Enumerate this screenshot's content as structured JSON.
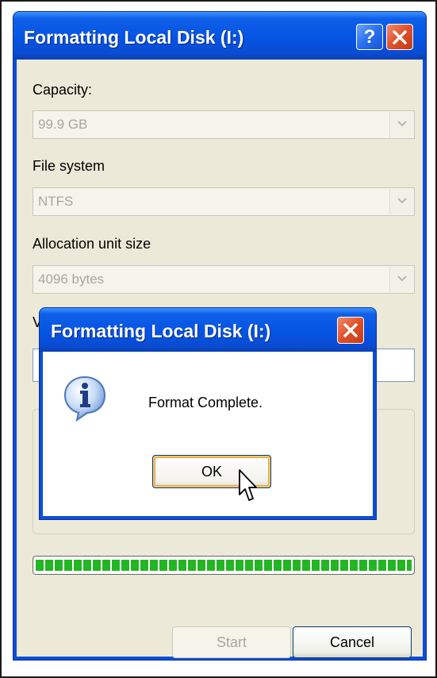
{
  "main_window": {
    "title": "Formatting Local Disk (I:)",
    "help_label": "?",
    "capacity": {
      "label": "Capacity:",
      "value": "99.9 GB"
    },
    "file_system": {
      "label": "File system",
      "value": "NTFS"
    },
    "allocation": {
      "label": "Allocation unit size",
      "value": "4096 bytes"
    },
    "volume_label_partial": "Vo",
    "progress_percent": 100,
    "buttons": {
      "start": "Start",
      "cancel": "Cancel"
    }
  },
  "message_box": {
    "title": "Formatting Local Disk (I:)",
    "message": "Format Complete.",
    "ok": "OK",
    "icon": "info-icon"
  },
  "colors": {
    "titlebar": "#0554e3",
    "dialog_bg": "#ece9d8",
    "progress": "#23b623",
    "close_button": "#e0502a"
  }
}
